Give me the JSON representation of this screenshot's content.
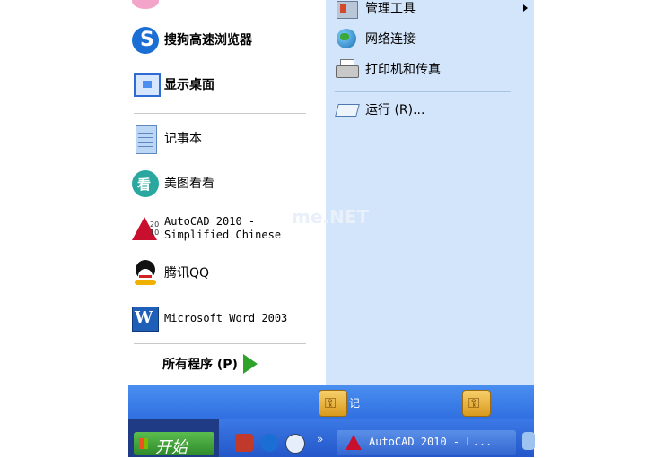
{
  "left_items": [
    {
      "id": "sogou-browser",
      "label": "搜狗高速浏览器",
      "bold": true
    },
    {
      "id": "show-desktop",
      "label": "显示桌面",
      "bold": true
    },
    {
      "id": "notepad",
      "label": "记事本",
      "bold": false
    },
    {
      "id": "meitu",
      "label": "美图看看",
      "bold": false
    },
    {
      "id": "autocad",
      "label": "AutoCAD 2010 -\nSimplified Chinese",
      "bold": false
    },
    {
      "id": "qq",
      "label": "腾讯QQ",
      "bold": false
    },
    {
      "id": "word",
      "label": "Microsoft Word 2003",
      "bold": false
    }
  ],
  "all_programs": "所有程序 (P)",
  "right_items": [
    {
      "id": "admin-tools",
      "label": "管理工具"
    },
    {
      "id": "network",
      "label": "网络连接"
    },
    {
      "id": "printers",
      "label": "打印机和传真"
    },
    {
      "id": "run",
      "label": "运行 (R)..."
    }
  ],
  "bottom_bar": {
    "logoff_label": "记"
  },
  "taskbar": {
    "start_label": "开始",
    "autocad_task": "AutoCAD 2010 - L..."
  },
  "watermark": "me.NET"
}
